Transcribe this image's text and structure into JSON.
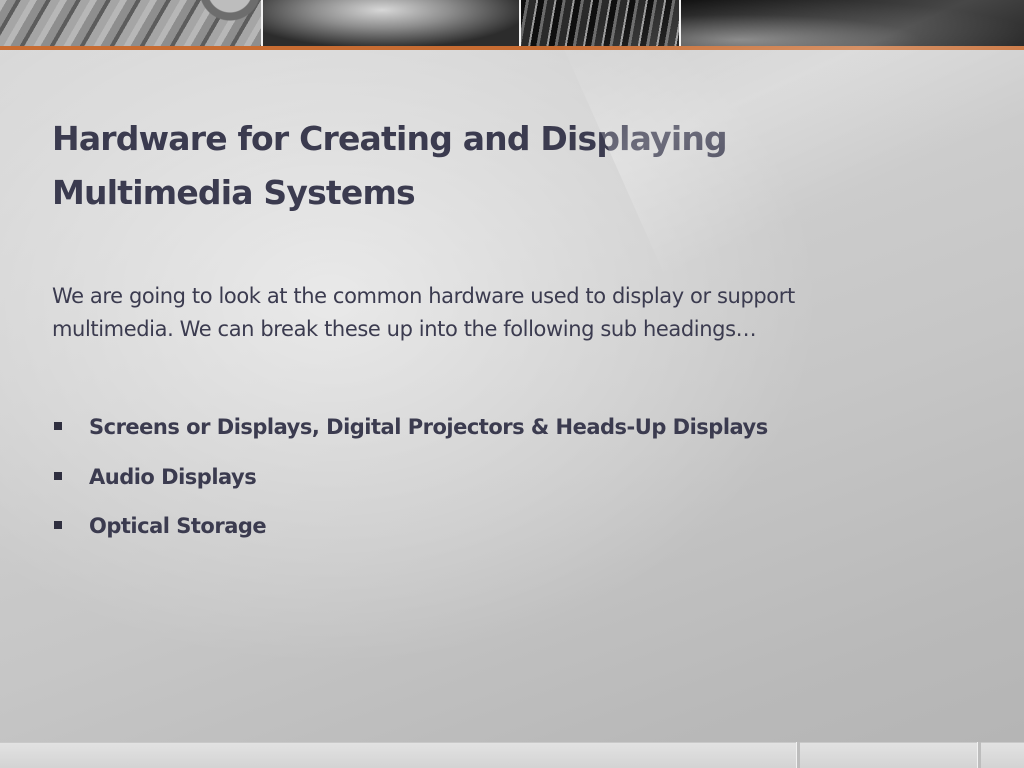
{
  "slide": {
    "title_lines": [
      "Hardware for Creating and Displaying",
      "Multimedia Systems"
    ],
    "intro_lines": [
      "We are going to look at the common hardware used to display or support",
      "multimedia. We can break these up into the following sub headings…"
    ],
    "bullets": [
      "Screens or Displays, Digital Projectors & Heads-Up Displays",
      "Audio Displays",
      "Optical Storage"
    ]
  },
  "colors": {
    "text": "#3b3b4f",
    "accent": "#c86c32",
    "bullet_marker": "#2f2f3f"
  }
}
